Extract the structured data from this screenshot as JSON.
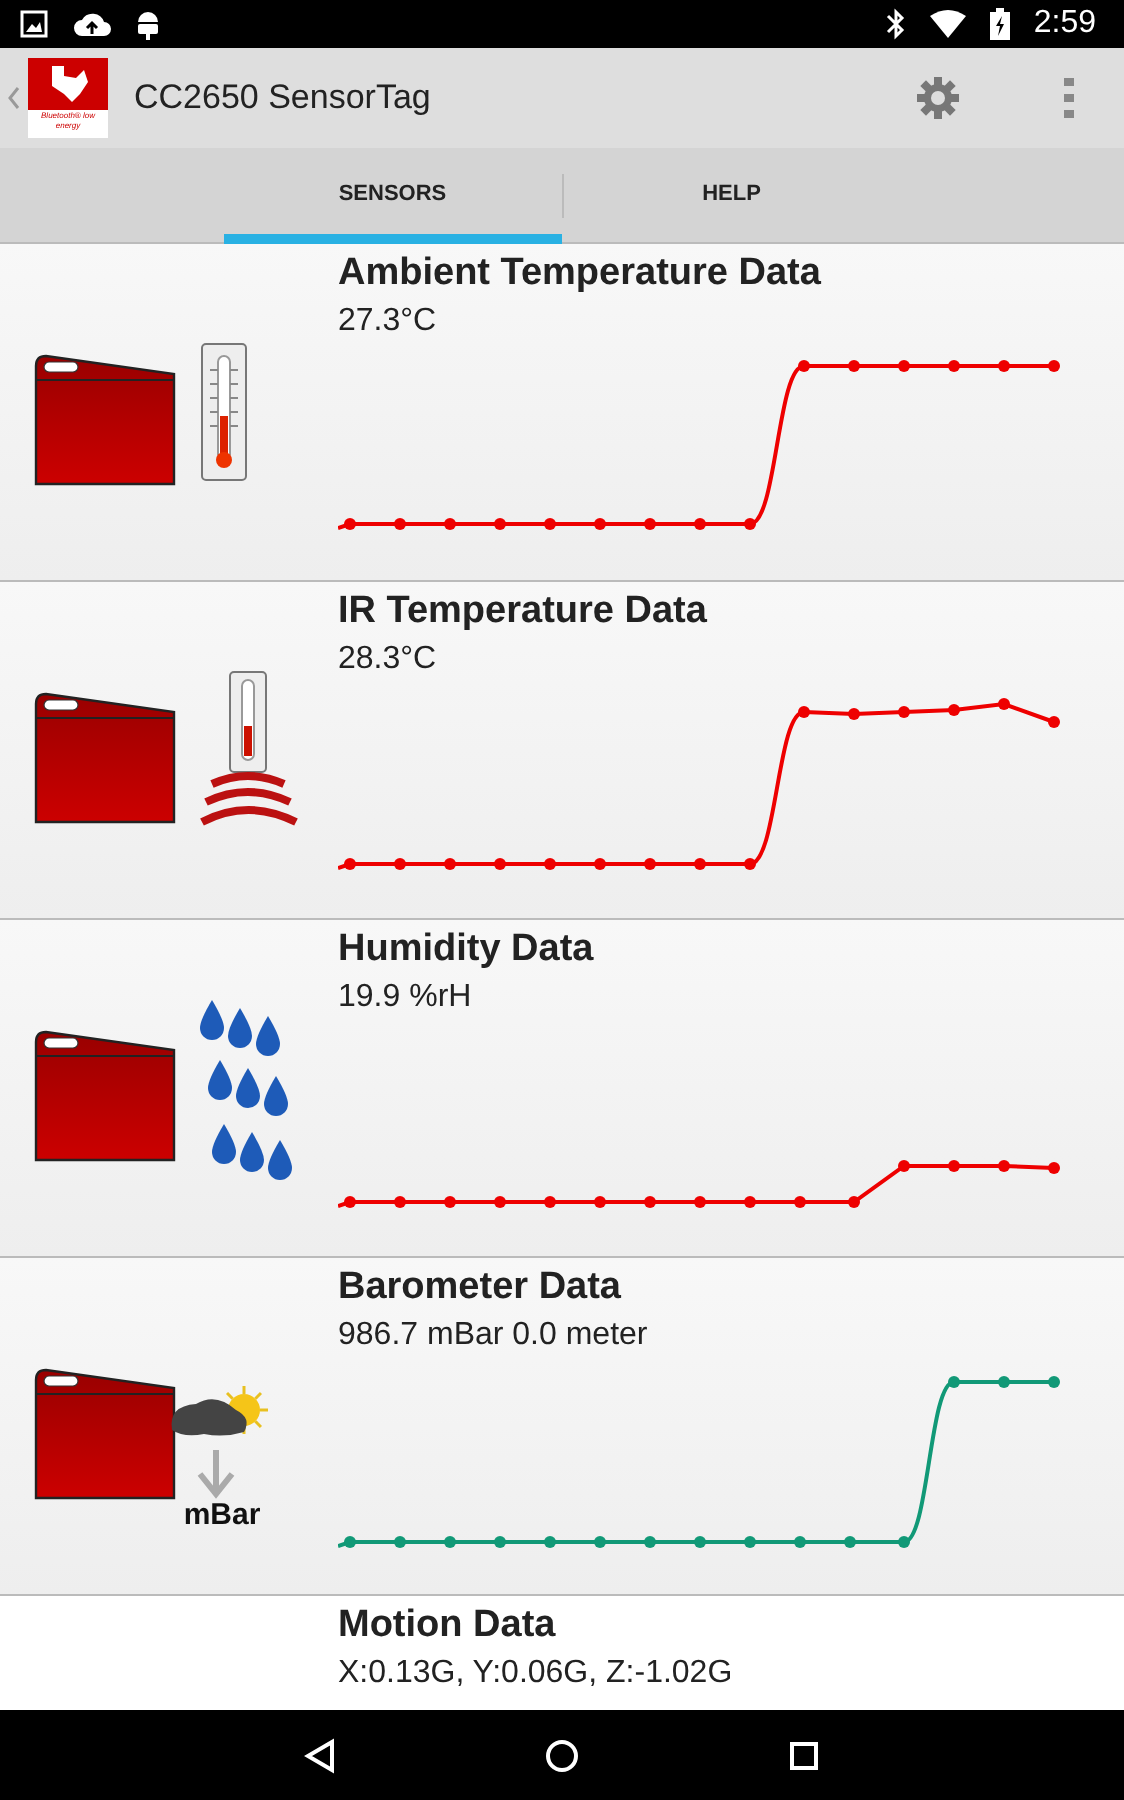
{
  "status_bar": {
    "time": "2:59"
  },
  "app_bar": {
    "logo_text": "Bluetooth® low energy",
    "title": "CC2650 SensorTag"
  },
  "tabs": [
    {
      "label": "SENSORS",
      "selected": true
    },
    {
      "label": "HELP",
      "selected": false
    }
  ],
  "sensors": [
    {
      "kind": "ambient",
      "title": "Ambient Temperature Data",
      "value": "27.3°C",
      "color": "#ee0000"
    },
    {
      "kind": "ir",
      "title": "IR Temperature Data",
      "value": "28.3°C",
      "color": "#ee0000"
    },
    {
      "kind": "humidity",
      "title": "Humidity Data",
      "value": "19.9 %rH",
      "color": "#ee0000"
    },
    {
      "kind": "barometer",
      "title": "Barometer Data",
      "value": "986.7 mBar 0.0 meter",
      "color": "#119977",
      "icon_label": "mBar"
    },
    {
      "kind": "motion",
      "title": "Motion Data",
      "value": "X:0.13G, Y:0.06G, Z:-1.02G"
    }
  ]
}
